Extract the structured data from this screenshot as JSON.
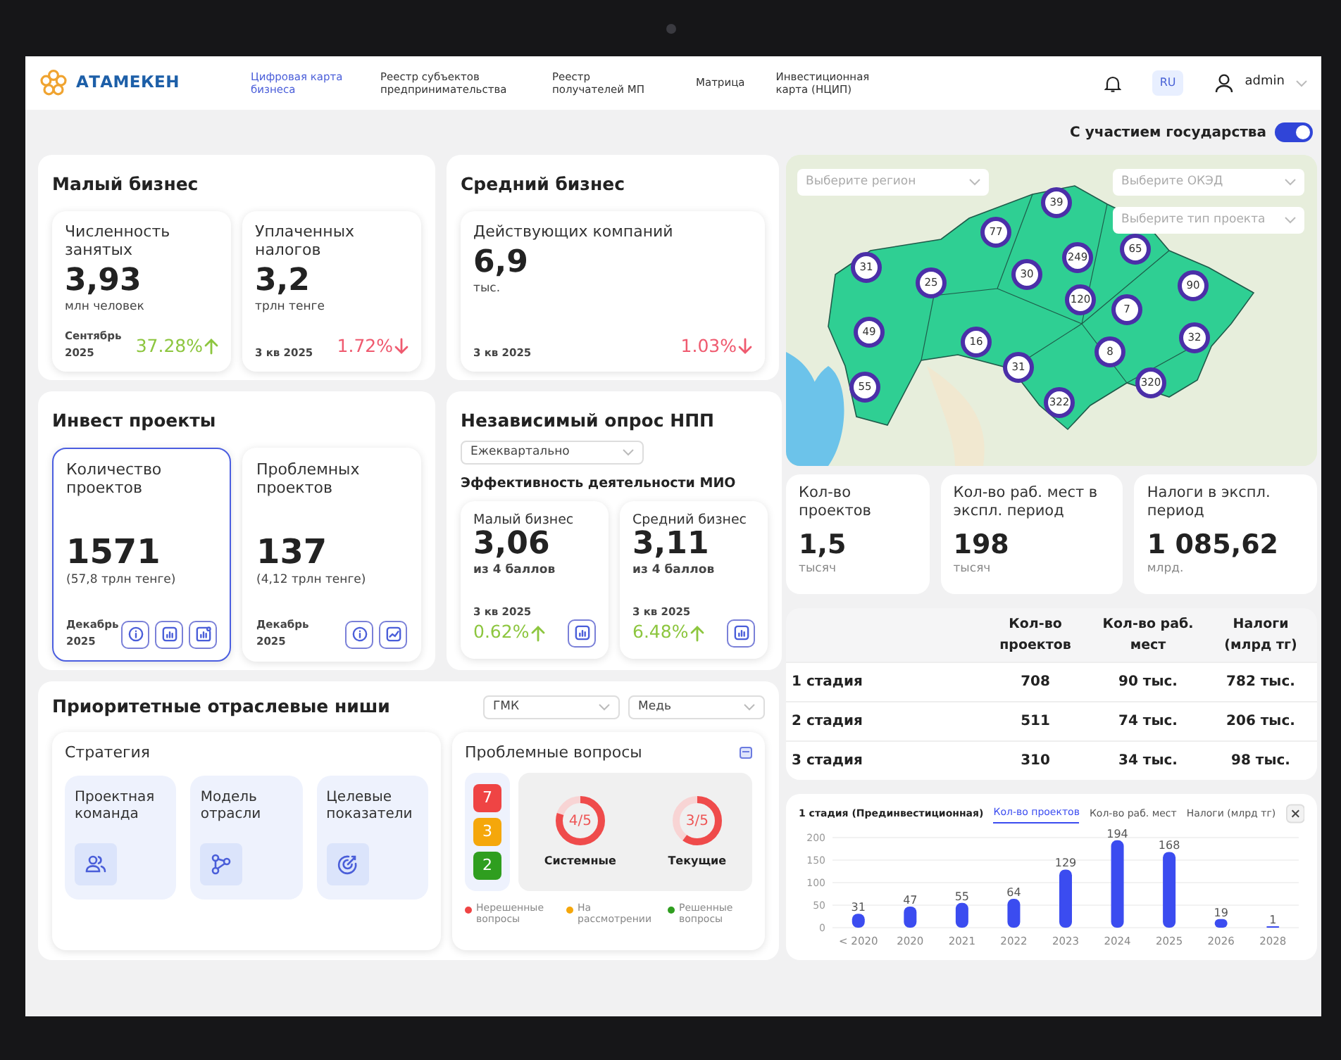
{
  "nav": {
    "logo": "АТАМЕКЕН",
    "links": [
      {
        "label": "Цифровая карта бизнеса",
        "selected": true
      },
      {
        "label": "Реестр субъектов предпринимательства",
        "selected": false
      },
      {
        "label": "Реестр получателей МП",
        "selected": false
      },
      {
        "label": "Матрица",
        "selected": false
      },
      {
        "label": "Инвестиционная карта (НЦИП)",
        "selected": false
      }
    ],
    "language": "RU",
    "user": "admin"
  },
  "toggle": {
    "label": "С участием государства",
    "on": true
  },
  "small_business": {
    "title": "Малый бизнес",
    "metrics": [
      {
        "label": "Численность занятых",
        "value": "3,93",
        "unit": "млн человек",
        "period": "Сентябрь 2025",
        "change": "37.28%",
        "kind": "up"
      },
      {
        "label": "Уплаченных налогов",
        "value": "3,2",
        "unit": "трлн тенге",
        "period": "3 кв 2025",
        "change": "1.72%",
        "kind": "down"
      }
    ]
  },
  "medium_business": {
    "title": "Средний бизнес",
    "metrics": [
      {
        "label": "Действующих компаний",
        "value": "6,9",
        "unit": "тыс.",
        "period": "3 кв 2025",
        "change": "1.03%",
        "kind": "down"
      }
    ]
  },
  "invest_projects": {
    "title": "Инвест проекты",
    "metrics": [
      {
        "label": "Количество проектов",
        "value": "1571",
        "note": "(57,8 трлн тенге)",
        "period": "Декабрь 2025",
        "selected": true,
        "actions": [
          {
            "kind": "info"
          },
          {
            "kind": "chart"
          },
          {
            "kind": "chart-badge"
          }
        ]
      },
      {
        "label": "Проблемных проектов",
        "value": "137",
        "note": "(4,12 трлн тенге)",
        "period": "Декабрь 2025",
        "selected": false,
        "actions": [
          {
            "kind": "info"
          },
          {
            "kind": "report"
          }
        ]
      }
    ]
  },
  "survey": {
    "title": "Независимый опрос НПП",
    "period_select": "Ежеквартально",
    "subtitle": "Эффективность деятельности МИО",
    "metrics": [
      {
        "label": "Малый бизнес",
        "value": "3,06",
        "unit": "из 4 баллов",
        "period": "3 кв 2025",
        "change": "0.62%",
        "kind": "up"
      },
      {
        "label": "Средний бизнес",
        "value": "3,11",
        "unit": "из 4 баллов",
        "period": "3 кв 2025",
        "change": "6.48%",
        "kind": "up"
      }
    ]
  },
  "niches": {
    "title": "Приоритетные отраслевые ниши",
    "selects": [
      "ГМК",
      "Медь"
    ],
    "strategy": {
      "title": "Стратегия",
      "items": [
        {
          "label": "Проектная команда",
          "kind": "team"
        },
        {
          "label": "Модель отрасли",
          "kind": "model"
        },
        {
          "label": "Целевые показатели",
          "kind": "target"
        }
      ]
    },
    "problems": {
      "title": "Проблемные вопросы",
      "counts": [
        {
          "value": "7",
          "color": "#ef4444"
        },
        {
          "value": "3",
          "color": "#f5a70b"
        },
        {
          "value": "2",
          "color": "#2f9e1f"
        }
      ],
      "rings": [
        {
          "value": "4/5",
          "label": "Системные",
          "level": 0.8
        },
        {
          "value": "3/5",
          "label": "Текущие",
          "level": 0.6
        }
      ],
      "legend": [
        {
          "label": "Нерешенные вопросы",
          "color": "#ef4444"
        },
        {
          "label": "На рассмотрении",
          "color": "#f5a70b"
        },
        {
          "label": "Решенные вопросы",
          "color": "#2f9e1f"
        }
      ]
    }
  },
  "map": {
    "selects": [
      "Выберите регион",
      "Выберите ОКЭД",
      "Выберите тип проекта"
    ],
    "markers": [
      "39",
      "77",
      "249",
      "65",
      "31",
      "25",
      "30",
      "90",
      "120",
      "7",
      "49",
      "16",
      "32",
      "8",
      "31",
      "320",
      "55",
      "322"
    ]
  },
  "kpis": [
    {
      "label": "Кол-во проектов",
      "value": "1,5",
      "unit": "тысяч"
    },
    {
      "label": "Кол-во раб. мест в экспл. период",
      "value": "198",
      "unit": "тысяч"
    },
    {
      "label": "Налоги в экспл. период",
      "value": "1 085,62",
      "unit": "млрд."
    }
  ],
  "stages": {
    "columns": [
      "Кол-во проектов",
      "Кол-во раб. мест",
      "Налоги (млрд тг)"
    ],
    "rows": [
      {
        "stage": "1 стадия",
        "cells": [
          "708",
          "90 тыс.",
          "782 тыс."
        ]
      },
      {
        "stage": "2 стадия",
        "cells": [
          "511",
          "74 тыс.",
          "206 тыс."
        ]
      },
      {
        "stage": "3 стадия",
        "cells": [
          "310",
          "34 тыс.",
          "98 тыс."
        ]
      }
    ]
  },
  "stage_chart": {
    "title": "1 стадия (Прединвестиционная)",
    "tabs": [
      {
        "label": "Кол-во проектов",
        "selected": true
      },
      {
        "label": "Кол-во раб. мест",
        "selected": false
      },
      {
        "label": "Налоги (млрд тг)",
        "selected": false
      }
    ],
    "chart_data": {
      "type": "bar",
      "categories": [
        "< 2020",
        "2020",
        "2021",
        "2022",
        "2023",
        "2024",
        "2025",
        "2026",
        "2028"
      ],
      "series": [
        {
          "color": "#3b4cf0",
          "values": [
            31,
            47,
            55,
            64,
            129,
            194,
            168,
            19,
            1
          ]
        }
      ],
      "ylim": [
        0,
        200
      ],
      "yticks": [
        0,
        50,
        100,
        150,
        200
      ],
      "grid": true,
      "data_labels": true
    }
  }
}
